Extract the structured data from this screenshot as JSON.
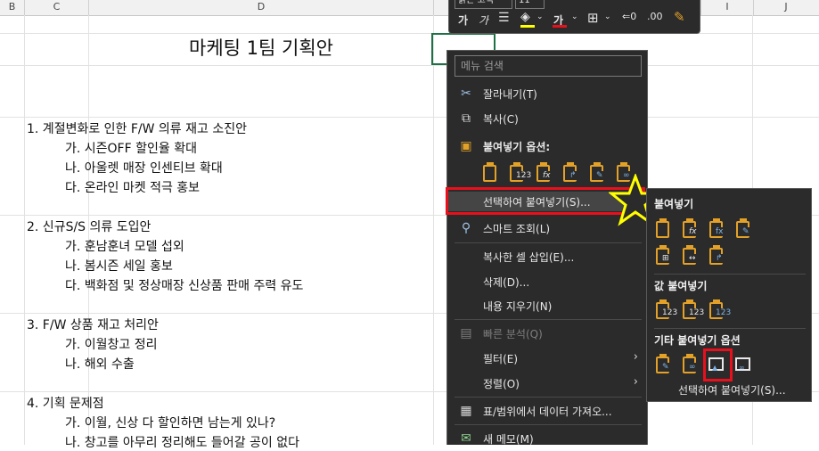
{
  "columns": [
    "B",
    "C",
    "D",
    "I",
    "J"
  ],
  "title": "마케팅 1팀 기획안",
  "rows": [
    {
      "text": "1. 계절변화로 인한 F/W 의류 재고 소진안",
      "indent": 0
    },
    {
      "text": "가.   시즌OFF 할인율 확대",
      "indent": 1
    },
    {
      "text": "나.   아울렛 매장 인센티브 확대",
      "indent": 1
    },
    {
      "text": "다.   온라인 마켓 적극 홍보",
      "indent": 1
    },
    {
      "text": "2. 신규S/S 의류 도입안",
      "indent": 0
    },
    {
      "text": "가.   훈남훈녀 모델 섭외",
      "indent": 1
    },
    {
      "text": "나.   봄시즌 세일 홍보",
      "indent": 1
    },
    {
      "text": "다.   백화점 및 정상매장 신상품 판매 주력 유도",
      "indent": 1
    },
    {
      "text": "3. F/W 상품 재고 처리안",
      "indent": 0
    },
    {
      "text": "가.   이월창고 정리",
      "indent": 1
    },
    {
      "text": "나.   해외 수출",
      "indent": 1
    },
    {
      "text": "4. 기획 문제점",
      "indent": 0
    },
    {
      "text": "가.   이월, 신상 다 할인하면 남는게 있나?",
      "indent": 1
    },
    {
      "text": "나.   창고를 아무리 정리해도 들어갈 공이 없다",
      "indent": 1
    }
  ],
  "mini_toolbar": {
    "font_name": "맑은 고딕",
    "font_size": "11",
    "bold": "가",
    "italic": "가",
    "font_color_glyph": "가"
  },
  "context_menu": {
    "search_placeholder": "메뉴 검색",
    "cut": "잘라내기(T)",
    "copy": "복사(C)",
    "paste_options": "붙여넣기 옵션:",
    "paste_special": "선택하여 붙여넣기(S)...",
    "smart_lookup": "스마트 조회(L)",
    "insert_copied": "복사한 셀 삽입(E)...",
    "delete": "삭제(D)...",
    "clear_contents": "내용 지우기(N)",
    "quick_analysis": "빠른 분석(Q)",
    "filter": "필터(E)",
    "sort": "정렬(O)",
    "get_data": "표/범위에서 데이터 가져오...",
    "new_memo": "새 메모(M)"
  },
  "submenu": {
    "paste_header": "붙여넣기",
    "values_header": "값 붙여넣기",
    "other_header": "기타 붙여넣기 옵션",
    "paste_special_footer": "선택하여 붙여넣기(S)..."
  },
  "colors": {
    "highlight_red": "#e8101c",
    "star_yellow": "#ffff00",
    "excel_green": "#1e7145"
  }
}
